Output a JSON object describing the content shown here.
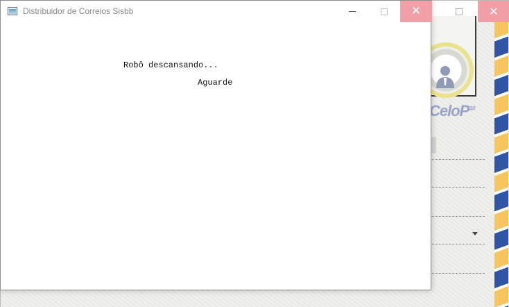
{
  "window": {
    "title": "Distribuidor de Correios Sisbb",
    "icon": "app-window-icon",
    "controls": {
      "minimize": "minimize-icon",
      "maximize": "maximize-icon",
      "close": "close-icon"
    }
  },
  "content": {
    "status_message": "Robô descansando...",
    "wait_message": "Aguarde"
  },
  "background_window": {
    "logo": "CeloP",
    "logo_version": "3.0",
    "controls": {
      "maximize": "maximize-icon",
      "close": "close-icon"
    }
  },
  "colors": {
    "close_button": "#f1a0a6",
    "airmail_yellow": "#f7c560",
    "airmail_blue": "#2f55a4",
    "seal_ring": "#e9e38d"
  }
}
